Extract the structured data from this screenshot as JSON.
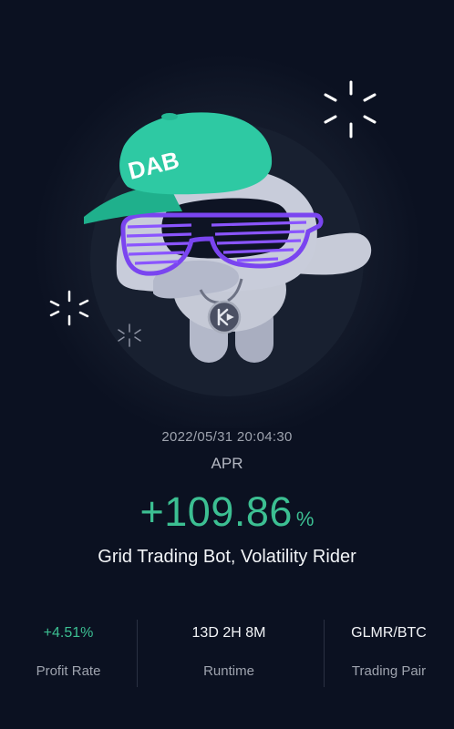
{
  "card": {
    "mascot_hat_text": "DAB",
    "timestamp": "2022/05/31 20:04:30",
    "apr_label": "APR",
    "apr_value": "+109.86",
    "apr_unit": "%",
    "bot_name": "Grid Trading Bot, Volatility Rider"
  },
  "stats": [
    {
      "value": "+4.51%",
      "label": "Profit Rate"
    },
    {
      "value": "13D 2H 8M",
      "label": "Runtime"
    },
    {
      "value": "GLMR/BTC",
      "label": "Trading Pair"
    }
  ],
  "colors": {
    "background": "#0b1121",
    "accent_green": "#3cbf92",
    "hat_teal": "#2ec9a3",
    "glasses_purple": "#7a45f0",
    "robot_gray": "#bfc4d4"
  },
  "icons": {
    "mascot": "dabbing-robot-illustration",
    "chain_badge": "kucoin-logo-icon",
    "sparkles": "sparkle-icon"
  }
}
